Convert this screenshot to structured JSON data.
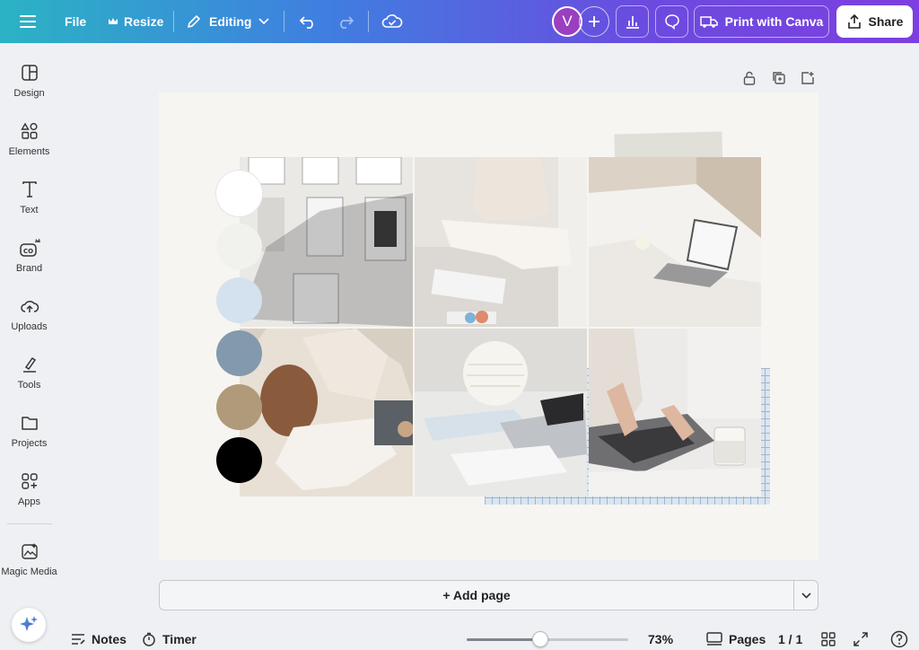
{
  "topbar": {
    "file_label": "File",
    "resize_label": "Resize",
    "editing_label": "Editing",
    "avatar_initial": "V",
    "print_label": "Print with Canva",
    "share_label": "Share"
  },
  "sidebar": {
    "items": [
      {
        "label": "Design",
        "icon": "design-icon"
      },
      {
        "label": "Elements",
        "icon": "elements-icon"
      },
      {
        "label": "Text",
        "icon": "text-icon"
      },
      {
        "label": "Brand",
        "icon": "brand-icon"
      },
      {
        "label": "Uploads",
        "icon": "uploads-icon"
      },
      {
        "label": "Tools",
        "icon": "tools-icon"
      },
      {
        "label": "Projects",
        "icon": "projects-icon"
      },
      {
        "label": "Apps",
        "icon": "apps-icon"
      },
      {
        "label": "Magic Media",
        "icon": "magic-media-icon"
      }
    ]
  },
  "design": {
    "palette": [
      "#ffffff",
      "#f1f1ee",
      "#d3e2ee",
      "#8399ad",
      "#b09a79",
      "#000000"
    ]
  },
  "canvas": {
    "add_page_label": "+ Add page"
  },
  "bottom": {
    "notes_label": "Notes",
    "timer_label": "Timer",
    "zoom": "73%",
    "pages_label": "Pages",
    "page_count": "1 / 1"
  },
  "colors": {
    "brand_gradient_start": "#2bb3c4",
    "brand_gradient_end": "#7d3fe0",
    "avatar": "#9a3fbf"
  }
}
